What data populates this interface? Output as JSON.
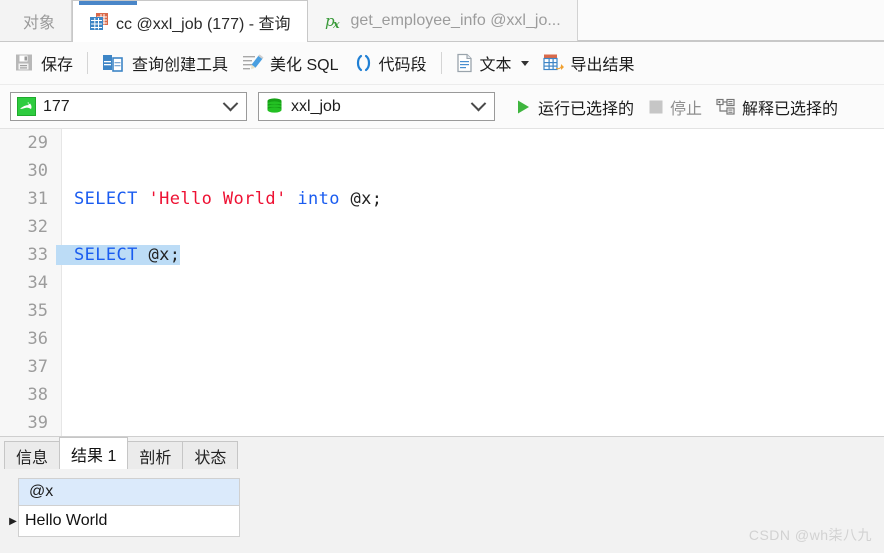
{
  "tabs": [
    {
      "label": "对象",
      "icon": "objects-icon",
      "state": "inactive"
    },
    {
      "label": "cc @xxl_job (177) - 查询",
      "icon": "query-table-icon",
      "state": "active"
    },
    {
      "label": "get_employee_info @xxl_jo...",
      "icon": "function-px-icon",
      "state": "dim"
    }
  ],
  "toolbar": {
    "save_label": "保存",
    "query_builder_label": "查询创建工具",
    "beautify_sql_label": "美化 SQL",
    "code_snippet_label": "代码段",
    "text_label": "文本",
    "export_results_label": "导出结果"
  },
  "combos": {
    "connection_value": "177",
    "connection_icon": "mysql-dolphin-icon",
    "database_value": "xxl_job",
    "database_icon": "database-icon"
  },
  "run_bar": {
    "run_selected_label": "运行已选择的",
    "run_icon": "play-triangle-icon",
    "stop_label": "停止",
    "stop_icon": "stop-square-icon",
    "stop_disabled": true,
    "explain_selected_label": "解释已选择的",
    "explain_icon": "explain-plan-icon"
  },
  "editor": {
    "lines": [
      {
        "num": "29",
        "segments": []
      },
      {
        "num": "30",
        "segments": []
      },
      {
        "num": "31",
        "segments": [
          {
            "text": "SELECT",
            "cls": "kw"
          },
          {
            "text": " ",
            "cls": "plain"
          },
          {
            "text": "'Hello World'",
            "cls": "str"
          },
          {
            "text": " ",
            "cls": "plain"
          },
          {
            "text": "into",
            "cls": "kw"
          },
          {
            "text": " @x;",
            "cls": "plain"
          }
        ],
        "selected": false
      },
      {
        "num": "32",
        "segments": []
      },
      {
        "num": "33",
        "segments": [
          {
            "text": "SELECT",
            "cls": "kw"
          },
          {
            "text": " @x;",
            "cls": "plain"
          }
        ],
        "selected": true
      },
      {
        "num": "34",
        "segments": []
      },
      {
        "num": "35",
        "segments": []
      },
      {
        "num": "36",
        "segments": []
      },
      {
        "num": "37",
        "segments": []
      },
      {
        "num": "38",
        "segments": []
      },
      {
        "num": "39",
        "segments": []
      }
    ]
  },
  "result_panel": {
    "tabs": [
      {
        "label": "信息",
        "active": false
      },
      {
        "label": "结果 1",
        "active": true
      },
      {
        "label": "剖析",
        "active": false
      },
      {
        "label": "状态",
        "active": false
      }
    ],
    "grid": {
      "columns": [
        "@x"
      ],
      "rows": [
        {
          "marker": "▶",
          "cells": [
            "Hello World"
          ]
        }
      ]
    }
  },
  "watermark": "CSDN @wh柒八九",
  "colors": {
    "keyword_blue": "#1a5cf0",
    "string_red": "#ee1133",
    "selection_blue": "#bcdcf6",
    "grid_header_blue": "#dbeafb",
    "run_green": "#3eb53e",
    "accent_blue": "#4a86c8"
  }
}
